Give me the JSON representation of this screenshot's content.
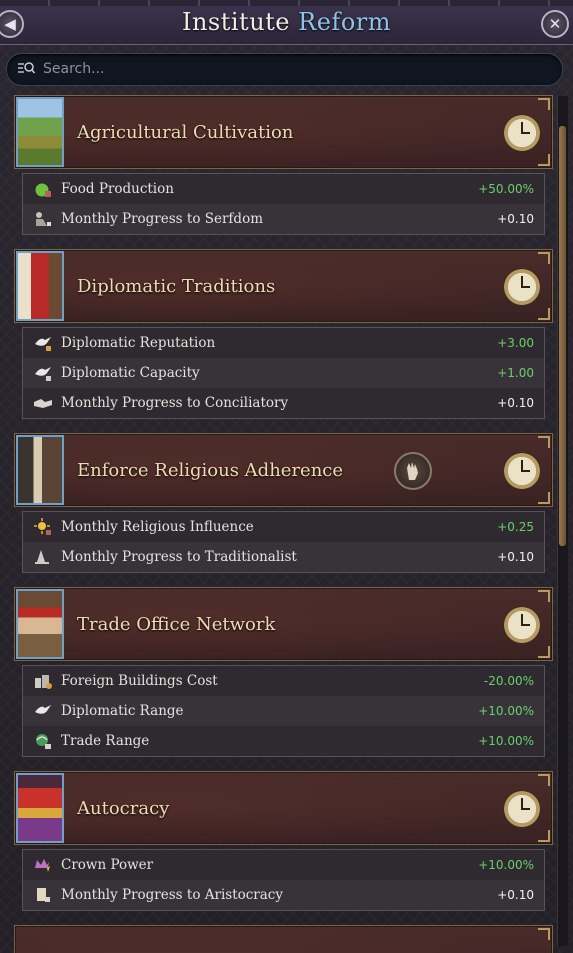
{
  "window": {
    "title_main": "Institute",
    "title_accent": "Reform"
  },
  "search": {
    "placeholder": "Search..."
  },
  "colors": {
    "accent": "#8fc4ea",
    "positive": "#6ad06a",
    "neutral": "#f2f2f2",
    "gold": "#efdcb2"
  },
  "groups": [
    {
      "title": "Agricultural Cultivation",
      "portrait_icon": "farm-field-icon",
      "status_icon": "clock-icon",
      "effects": [
        {
          "icon": "apple-icon",
          "label": "Food Production",
          "value": "+50.00%",
          "tone": "positive"
        },
        {
          "icon": "serf-icon",
          "label": "Monthly Progress to Serfdom",
          "value": "+0.10",
          "tone": "neutral"
        }
      ]
    },
    {
      "title": "Diplomatic Traditions",
      "portrait_icon": "diplomat-icon",
      "status_icon": "clock-icon",
      "effects": [
        {
          "icon": "dove-icon",
          "label": "Diplomatic Reputation",
          "value": "+3.00",
          "tone": "positive"
        },
        {
          "icon": "dove-icon",
          "label": "Diplomatic Capacity",
          "value": "+1.00",
          "tone": "positive"
        },
        {
          "icon": "handshake-icon",
          "label": "Monthly Progress to Conciliatory",
          "value": "+0.10",
          "tone": "neutral"
        }
      ]
    },
    {
      "title": "Enforce Religious Adherence",
      "portrait_icon": "clergy-icon",
      "status_icon": "clock-icon",
      "extra_icon": "hand-gesture-icon",
      "effects": [
        {
          "icon": "religious-sun-icon",
          "label": "Monthly Religious Influence",
          "value": "+0.25",
          "tone": "positive"
        },
        {
          "icon": "scales-icon",
          "label": "Monthly Progress to Traditionalist",
          "value": "+0.10",
          "tone": "neutral"
        }
      ]
    },
    {
      "title": "Trade Office Network",
      "portrait_icon": "merchant-icon",
      "status_icon": "clock-icon",
      "effects": [
        {
          "icon": "buildings-icon",
          "label": "Foreign Buildings Cost",
          "value": "-20.00%",
          "tone": "positive"
        },
        {
          "icon": "dove-icon",
          "label": "Diplomatic Range",
          "value": "+10.00%",
          "tone": "positive"
        },
        {
          "icon": "globe-icon",
          "label": "Trade Range",
          "value": "+10.00%",
          "tone": "positive"
        }
      ]
    },
    {
      "title": "Autocracy",
      "portrait_icon": "crown-icon",
      "status_icon": "clock-icon",
      "effects": [
        {
          "icon": "crown-power-icon",
          "label": "Crown Power",
          "value": "+10.00%",
          "tone": "positive"
        },
        {
          "icon": "scroll-icon",
          "label": "Monthly Progress to Aristocracy",
          "value": "+0.10",
          "tone": "neutral"
        }
      ]
    }
  ]
}
